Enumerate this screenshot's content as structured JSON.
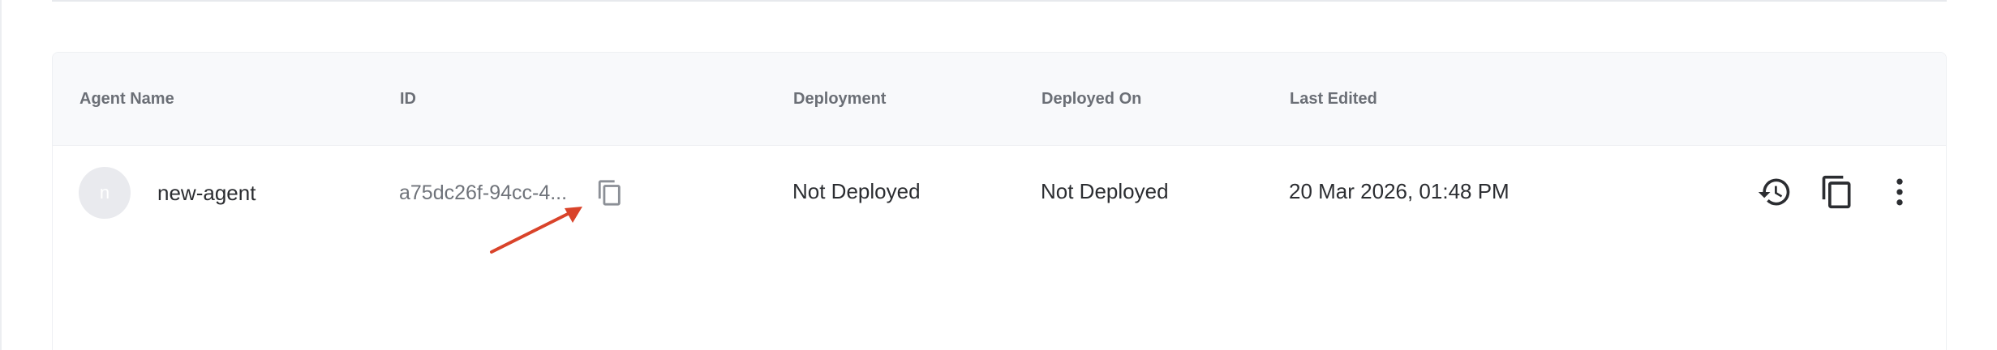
{
  "table": {
    "headers": {
      "agent_name": "Agent Name",
      "id": "ID",
      "deployment": "Deployment",
      "deployed_on": "Deployed On",
      "last_edited": "Last Edited"
    },
    "rows": [
      {
        "avatar_letter": "n",
        "agent_name": "new-agent",
        "id_truncated": "a75dc26f-94cc-4...",
        "deployment": "Not Deployed",
        "deployed_on": "Not Deployed",
        "last_edited": "20 Mar 2026, 01:48 PM",
        "actions": [
          "history-icon",
          "copy-icon",
          "more-vertical-icon"
        ]
      }
    ]
  },
  "annotation": {
    "arrow_color": "#d9432a",
    "target": "copy-id-icon"
  },
  "colors": {
    "header_bg": "#f8f9fb",
    "header_text": "#6b6f76",
    "body_text": "#2b2d31",
    "muted_text": "#6f737a",
    "icon": "#2b2d31"
  }
}
